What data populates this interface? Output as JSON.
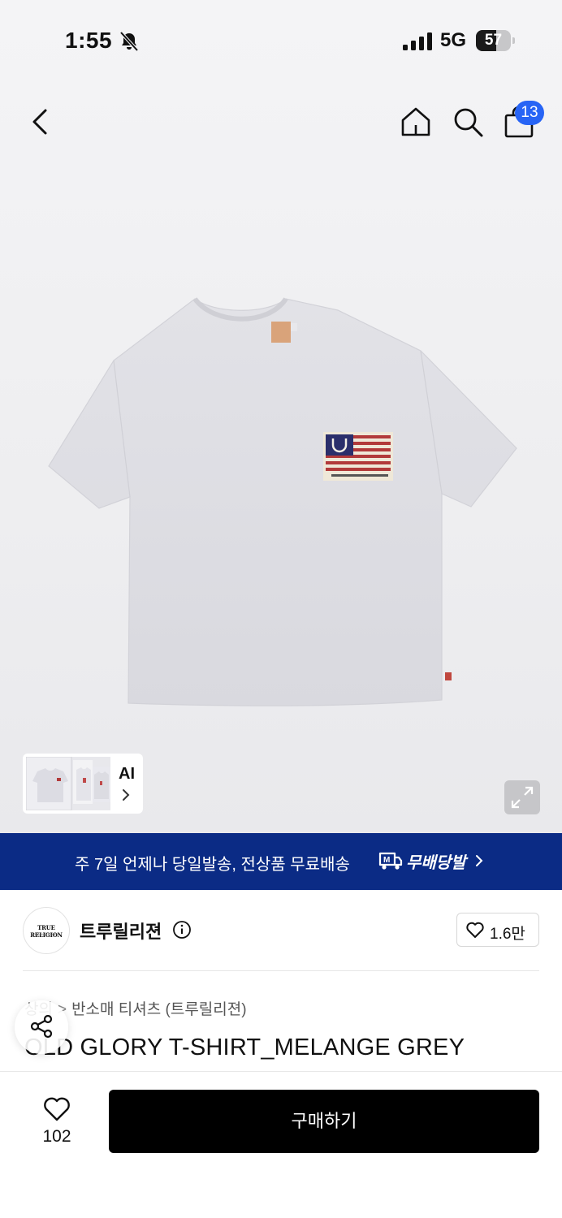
{
  "status_bar": {
    "time": "1:55",
    "network": "5G",
    "battery_level": "57",
    "battery_fraction": 0.57,
    "icons": [
      "bell-slash-icon",
      "cellular-signal-icon",
      "battery-icon"
    ]
  },
  "nav": {
    "icons": [
      "back-chevron-icon",
      "home-icon",
      "search-icon",
      "shopping-bag-icon"
    ],
    "cart_count": "13",
    "accent_color": "#2764f5"
  },
  "gallery": {
    "ai_label": "AI",
    "icons": [
      "chevron-right-icon",
      "expand-icon"
    ]
  },
  "banner": {
    "text": "주 7일 언제나 당일발송, 전상품 무료배송",
    "brand": "무배당발",
    "background_color": "#0b2b85",
    "icons": [
      "delivery-truck-icon",
      "chevron-right-icon"
    ]
  },
  "brand": {
    "name": "트루릴리젼",
    "logo_text": "TRUE RELIGION",
    "logo_subtext": "BRAND JEANS",
    "like_count": "1.6만",
    "icons": [
      "info-icon",
      "heart-outline-icon"
    ]
  },
  "product": {
    "breadcrumb": [
      "상의",
      "반소매 티셔츠 (트루릴리젼)"
    ],
    "title": "OLD GLORY T-SHIRT_MELANGE GREY"
  },
  "bottom_bar": {
    "wish_count": "102",
    "buy_label": "구매하기",
    "icons": [
      "heart-outline-icon",
      "share-icon"
    ]
  }
}
